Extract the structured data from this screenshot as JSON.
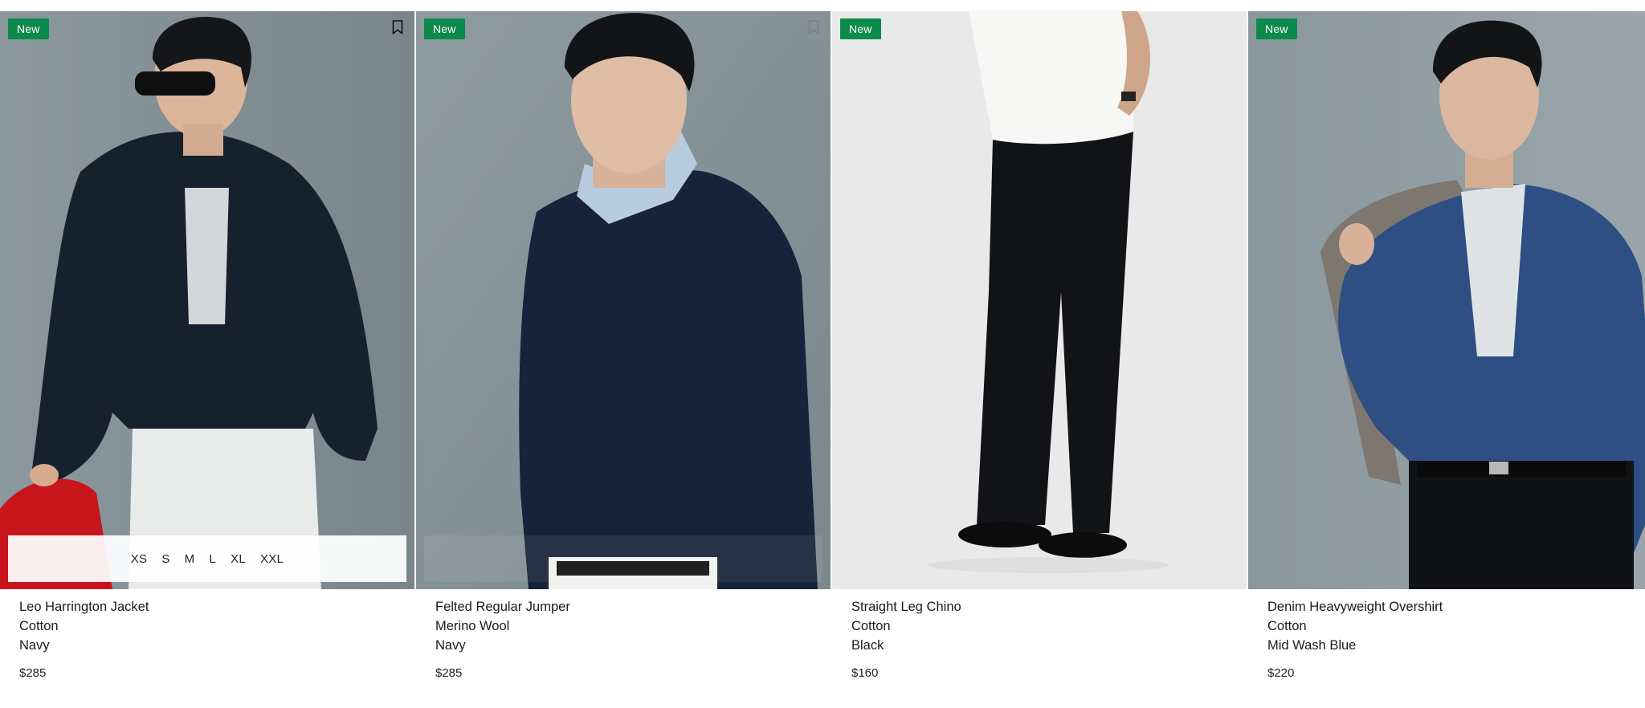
{
  "colors": {
    "badge_bg": "#0b8a4b",
    "text": "#1b1b1b"
  },
  "products": [
    {
      "badge": "New",
      "name": "Leo Harrington Jacket",
      "material": "Cotton",
      "color": "Navy",
      "price": "$285",
      "sizes": [
        "XS",
        "S",
        "M",
        "L",
        "XL",
        "XXL"
      ],
      "bookmark_icon": "bookmark-icon"
    },
    {
      "badge": "New",
      "name": "Felted Regular Jumper",
      "material": "Merino Wool",
      "color": "Navy",
      "price": "$285",
      "bookmark_icon": "bookmark-icon"
    },
    {
      "badge": "New",
      "name": "Straight Leg Chino",
      "material": "Cotton",
      "color": "Black",
      "price": "$160"
    },
    {
      "badge": "New",
      "name": "Denim Heavyweight Overshirt",
      "material": "Cotton",
      "color": "Mid Wash Blue",
      "price": "$220"
    }
  ]
}
